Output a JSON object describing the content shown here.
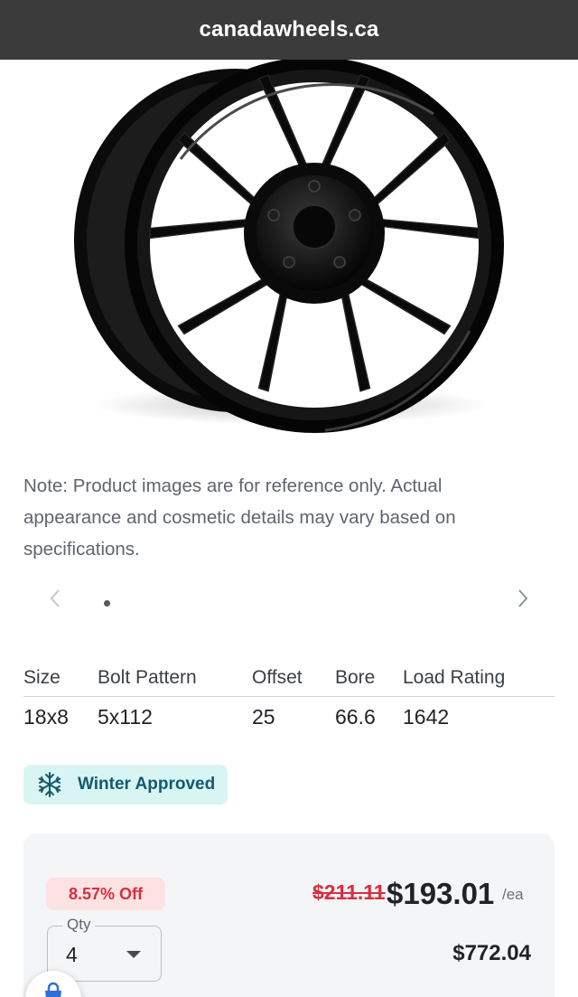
{
  "browser": {
    "domain": "canadawheels.ca"
  },
  "product": {
    "image_icon": "black-alloy-wheel",
    "note": "Note: Product images are for reference only. Actual appearance and cosmetic details may vary based on specifications."
  },
  "carousel": {
    "prev_icon": "chevron-left-icon",
    "next_icon": "chevron-right-icon",
    "dots": 1
  },
  "specs": {
    "headers": [
      "Size",
      "Bolt Pattern",
      "Offset",
      "Bore",
      "Load Rating"
    ],
    "values": [
      "18x8",
      "5x112",
      "25",
      "66.6",
      "1642"
    ]
  },
  "badge": {
    "icon": "snowflake-icon",
    "label": "Winter Approved",
    "color": "#14596f",
    "background": "#d9f5f3"
  },
  "pricing": {
    "discount": "8.57% Off",
    "old_price": "$211.11",
    "price": "$193.01",
    "unit": "/ea",
    "qty_label": "Qty",
    "qty_value": "4",
    "total": "$772.04",
    "sale_color": "#d92f3e"
  }
}
